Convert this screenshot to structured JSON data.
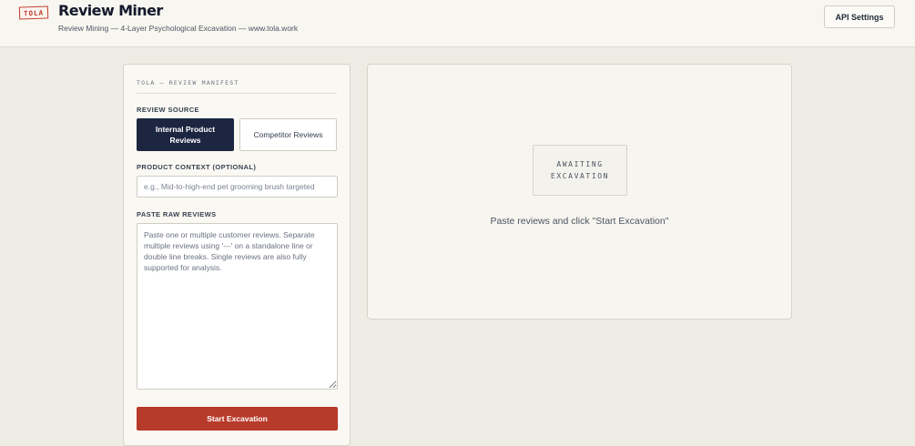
{
  "header": {
    "logo_text": "TOLA",
    "title": "Review Miner",
    "subtitle": "Review Mining — 4-Layer Psychological Excavation — www.tola.work",
    "api_button": "API Settings"
  },
  "form": {
    "manifest_label": "TOLA — REVIEW MANIFEST",
    "source_label": "REVIEW SOURCE",
    "source_options": [
      {
        "label": "Internal Product Reviews",
        "selected": true
      },
      {
        "label": "Competitor Reviews",
        "selected": false
      }
    ],
    "context_label": "PRODUCT CONTEXT (OPTIONAL)",
    "context_placeholder": "e.g., Mid-to-high-end pet grooming brush targeted",
    "raw_label": "PASTE RAW REVIEWS",
    "raw_placeholder": "Paste one or multiple customer reviews. Separate multiple reviews using '---' on a standalone line or double line breaks. Single reviews are also fully supported for analysis.",
    "submit_label": "Start Excavation"
  },
  "result": {
    "status_badge": "AWAITING EXCAVATION",
    "message": "Paste reviews and click \"Start Excavation\""
  },
  "colors": {
    "accent_red": "#b83a2b",
    "navy": "#1c2640",
    "background": "#eeede5"
  }
}
